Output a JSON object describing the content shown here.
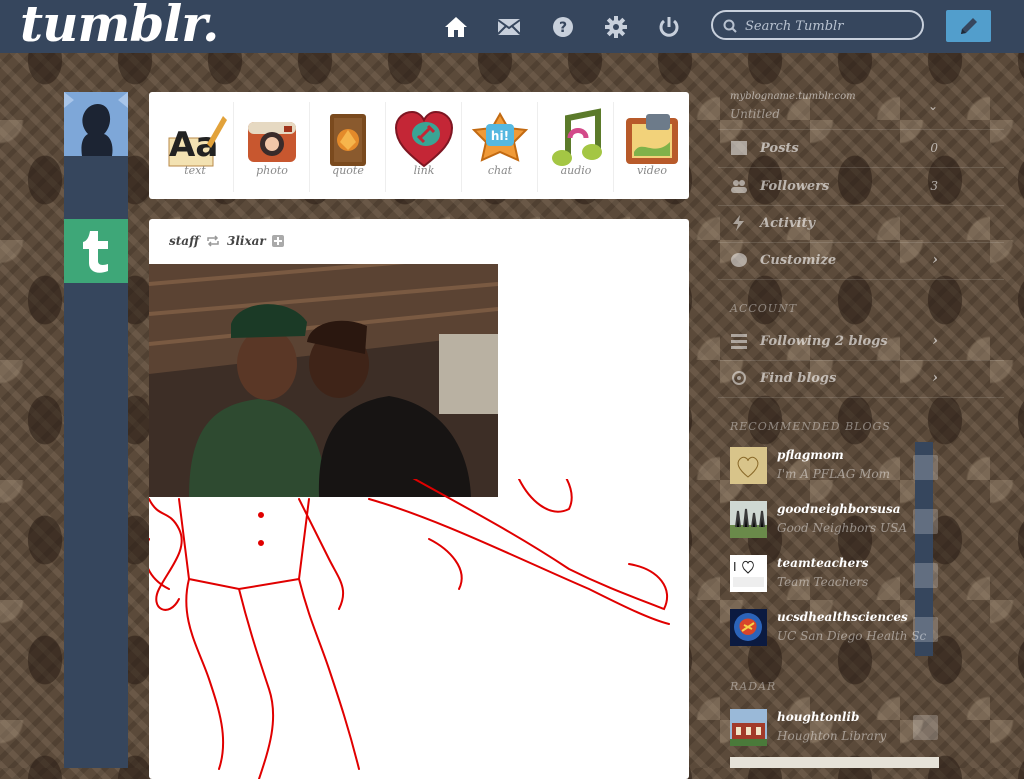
{
  "topbar": {
    "logo": "tumblr.",
    "search_placeholder": "Search Tumblr",
    "nav_icons": [
      "home-icon",
      "mail-icon",
      "help-icon",
      "settings-icon",
      "power-icon"
    ],
    "compose_icon": "pencil-icon"
  },
  "post_types": [
    {
      "label": "text",
      "icon": "text-icon"
    },
    {
      "label": "photo",
      "icon": "camera-icon"
    },
    {
      "label": "quote",
      "icon": "quote-icon"
    },
    {
      "label": "link",
      "icon": "link-icon"
    },
    {
      "label": "chat",
      "icon": "chat-icon"
    },
    {
      "label": "audio",
      "icon": "audio-icon"
    },
    {
      "label": "video",
      "icon": "video-icon"
    }
  ],
  "post": {
    "author": "staff",
    "reblogged_from": "3lixar"
  },
  "sidebar": {
    "blog_url": "myblogname.tumblr.com",
    "blog_title": "Untitled",
    "rows": [
      {
        "label": "Posts",
        "count": "0",
        "icon": "posts-icon"
      },
      {
        "label": "Followers",
        "count": "3",
        "icon": "followers-icon"
      },
      {
        "label": "Activity",
        "count": "",
        "icon": "activity-icon"
      },
      {
        "label": "Customize",
        "count": "",
        "icon": "palette-icon"
      }
    ],
    "account_heading": "ACCOUNT",
    "account_rows": [
      {
        "label": "Following 2 blogs",
        "icon": "following-icon"
      },
      {
        "label": "Find blogs",
        "icon": "find-blogs-icon"
      }
    ],
    "recommended_heading": "RECOMMENDED BLOGS",
    "recommended": [
      {
        "name": "pflagmom",
        "tagline": "I'm A PFLAG Mom"
      },
      {
        "name": "goodneighborsusa",
        "tagline": "Good Neighbors USA"
      },
      {
        "name": "teamteachers",
        "tagline": "Team Teachers"
      },
      {
        "name": "ucsdhealthsciences",
        "tagline": "UC San Diego Health Sc"
      }
    ],
    "radar_heading": "RADAR",
    "radar": {
      "name": "houghtonlib",
      "tagline": "Houghton Library"
    }
  },
  "colors": {
    "navy": "#36465d",
    "compose_blue": "#529ecc",
    "tumblr_green": "#3ea778",
    "drawing_red": "#e00000"
  }
}
